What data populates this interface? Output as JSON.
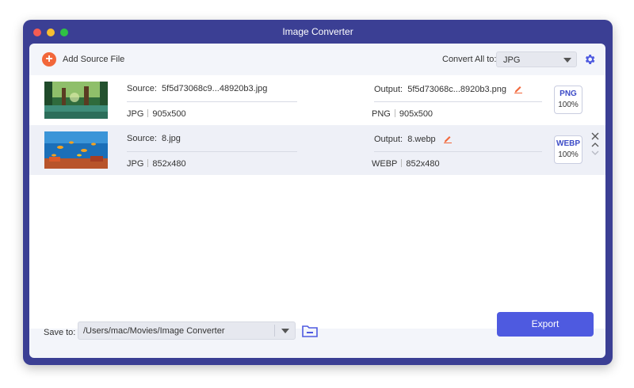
{
  "window": {
    "title": "Image Converter",
    "traffic_lights": [
      "#f45c52",
      "#f7be30",
      "#2fc244"
    ]
  },
  "toolbar": {
    "add_label": "Add Source File",
    "convert_all_label": "Convert All to:",
    "convert_all_value": "JPG"
  },
  "files": [
    {
      "source_label": "Source:",
      "source_name": "5f5d73068c9...48920b3.jpg",
      "source_format": "JPG",
      "source_size": "905x500",
      "output_label": "Output:",
      "output_name": "5f5d73068c...8920b3.png",
      "output_format": "PNG",
      "output_size": "905x500",
      "badge_format": "PNG",
      "badge_quality": "100%"
    },
    {
      "source_label": "Source:",
      "source_name": "8.jpg",
      "source_format": "JPG",
      "source_size": "852x480",
      "output_label": "Output:",
      "output_name": "8.webp",
      "output_format": "WEBP",
      "output_size": "852x480",
      "badge_format": "WEBP",
      "badge_quality": "100%"
    }
  ],
  "footer": {
    "save_to_label": "Save to:",
    "save_path": "/Users/mac/Movies/Image Converter",
    "export_label": "Export"
  },
  "colors": {
    "accent": "#4e5ae0",
    "add_button": "#f2673a",
    "edit_icon": "#f2673a",
    "window_frame": "#3b3f94"
  }
}
